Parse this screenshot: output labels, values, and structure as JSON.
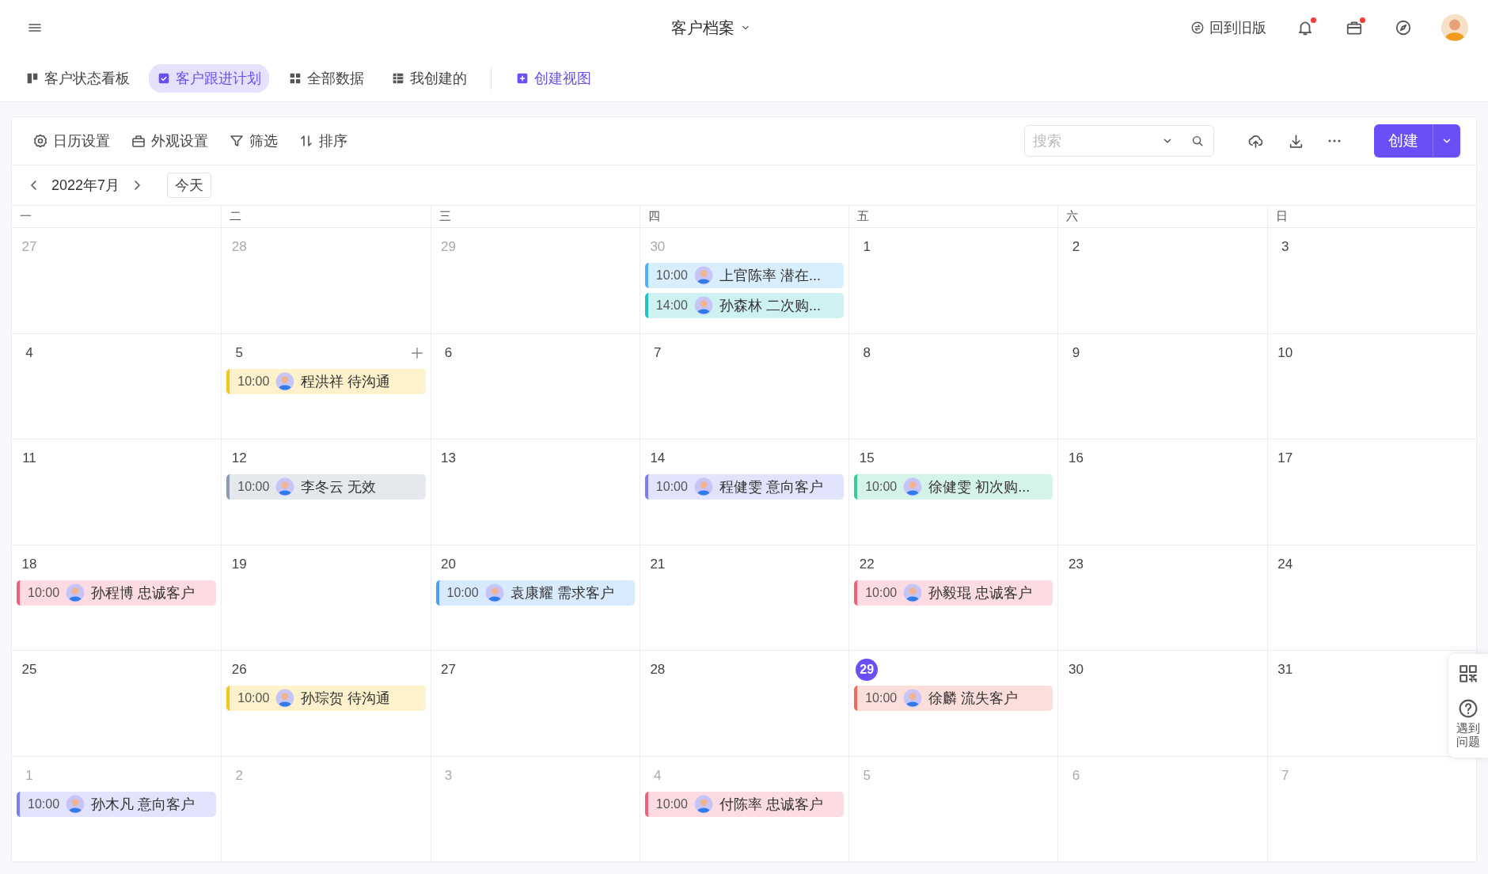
{
  "header": {
    "title": "客户档案",
    "back_link": "回到旧版",
    "icons": [
      {
        "kind": "bell",
        "dot": true
      },
      {
        "kind": "briefcase",
        "dot": true
      },
      {
        "kind": "compass",
        "dot": false
      }
    ]
  },
  "view_tabs": [
    {
      "label": "客户状态看板",
      "selected": false
    },
    {
      "label": "客户跟进计划",
      "selected": true
    },
    {
      "label": "全部数据",
      "selected": false
    },
    {
      "label": "我创建的",
      "selected": false
    }
  ],
  "create_view": "创建视图",
  "toolbar": {
    "buttons": [
      "日历设置",
      "外观设置",
      "筛选",
      "排序"
    ],
    "search": {
      "placeholder": "搜索"
    },
    "create_button": "创建"
  },
  "calendar": {
    "month": "2022年7月",
    "today_button": "今天",
    "weekdays": [
      "一",
      "二",
      "三",
      "四",
      "五",
      "六",
      "日"
    ],
    "weeks": [
      [
        {
          "day": "27",
          "muted": true,
          "today": false
        },
        {
          "day": "28",
          "muted": true,
          "today": false
        },
        {
          "day": "29",
          "muted": true,
          "today": false
        },
        {
          "day": "30",
          "muted": true,
          "today": false,
          "events": [
            {
              "time": "10:00",
              "text": "上官陈率 潜在...",
              "color": "#4db1f5"
            },
            {
              "time": "14:00",
              "text": "孙森林 二次购...",
              "color": "#22c3c3"
            }
          ]
        },
        {
          "day": "1",
          "muted": false,
          "today": false
        },
        {
          "day": "2",
          "muted": false,
          "today": false
        },
        {
          "day": "3",
          "muted": false,
          "today": false
        }
      ],
      [
        {
          "day": "4",
          "muted": false,
          "today": false
        },
        {
          "day": "5",
          "muted": false,
          "today": false,
          "hovered": true,
          "events": [
            {
              "time": "10:00",
              "text": "程洪祥 待沟通",
              "color": "#f5c518"
            }
          ]
        },
        {
          "day": "6",
          "muted": false,
          "today": false
        },
        {
          "day": "7",
          "muted": false,
          "today": false
        },
        {
          "day": "8",
          "muted": false,
          "today": false
        },
        {
          "day": "9",
          "muted": false,
          "today": false
        },
        {
          "day": "10",
          "muted": false,
          "today": false
        }
      ],
      [
        {
          "day": "11",
          "muted": false,
          "today": false
        },
        {
          "day": "12",
          "muted": false,
          "today": false,
          "events": [
            {
              "time": "10:00",
              "text": "李冬云 无效",
              "color": "#8a9bb3"
            }
          ]
        },
        {
          "day": "13",
          "muted": false,
          "today": false
        },
        {
          "day": "14",
          "muted": false,
          "today": false,
          "events": [
            {
              "time": "10:00",
              "text": "程健雯 意向客户",
              "color": "#7b7ef0"
            }
          ]
        },
        {
          "day": "15",
          "muted": false,
          "today": false,
          "events": [
            {
              "time": "10:00",
              "text": "徐健雯 初次购...",
              "color": "#3cc99a"
            }
          ]
        },
        {
          "day": "16",
          "muted": false,
          "today": false
        },
        {
          "day": "17",
          "muted": false,
          "today": false
        }
      ],
      [
        {
          "day": "18",
          "muted": false,
          "today": false,
          "events": [
            {
              "time": "10:00",
              "text": "孙程博 忠诚客户",
              "color": "#f0607a"
            }
          ]
        },
        {
          "day": "19",
          "muted": false,
          "today": false
        },
        {
          "day": "20",
          "muted": false,
          "today": false,
          "events": [
            {
              "time": "10:00",
              "text": "袁康耀 需求客户",
              "color": "#4d9ef5"
            }
          ]
        },
        {
          "day": "21",
          "muted": false,
          "today": false
        },
        {
          "day": "22",
          "muted": false,
          "today": false,
          "events": [
            {
              "time": "10:00",
              "text": "孙毅琨 忠诚客户",
              "color": "#f0607a"
            }
          ]
        },
        {
          "day": "23",
          "muted": false,
          "today": false
        },
        {
          "day": "24",
          "muted": false,
          "today": false
        }
      ],
      [
        {
          "day": "25",
          "muted": false,
          "today": false
        },
        {
          "day": "26",
          "muted": false,
          "today": false,
          "events": [
            {
              "time": "10:00",
              "text": "孙琮贺 待沟通",
              "color": "#f5c518"
            }
          ]
        },
        {
          "day": "27",
          "muted": false,
          "today": false
        },
        {
          "day": "28",
          "muted": false,
          "today": false
        },
        {
          "day": "29",
          "muted": false,
          "today": true,
          "events": [
            {
              "time": "10:00",
              "text": "徐麟 流失客户",
              "color": "#f06a5a"
            }
          ]
        },
        {
          "day": "30",
          "muted": false,
          "today": false
        },
        {
          "day": "31",
          "muted": false,
          "today": false
        }
      ],
      [
        {
          "day": "1",
          "muted": true,
          "today": false,
          "events": [
            {
              "time": "10:00",
              "text": "孙木凡 意向客户",
              "color": "#7b7ef0"
            }
          ]
        },
        {
          "day": "2",
          "muted": true,
          "today": false
        },
        {
          "day": "3",
          "muted": true,
          "today": false
        },
        {
          "day": "4",
          "muted": true,
          "today": false,
          "events": [
            {
              "time": "10:00",
              "text": "付陈率 忠诚客户",
              "color": "#f0607a"
            }
          ]
        },
        {
          "day": "5",
          "muted": true,
          "today": false
        },
        {
          "day": "6",
          "muted": true,
          "today": false
        },
        {
          "day": "7",
          "muted": true,
          "today": false
        }
      ]
    ]
  },
  "help": {
    "label": "遇到问题"
  }
}
